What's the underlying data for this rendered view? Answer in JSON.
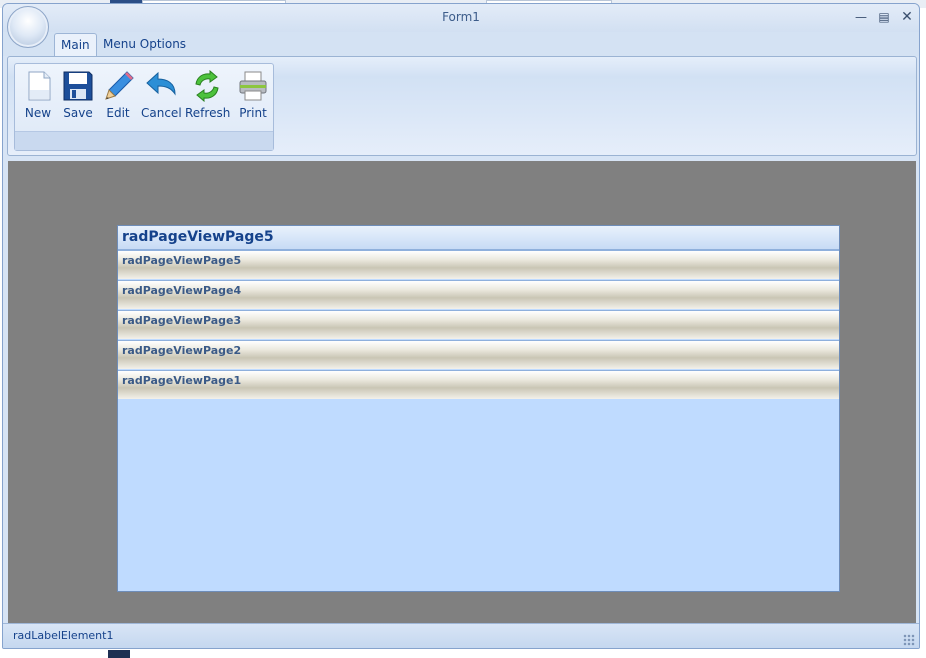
{
  "window": {
    "title": "Form1"
  },
  "ribbon": {
    "tabs": [
      {
        "label": "Main",
        "selected": true
      },
      {
        "label": "Menu Options",
        "selected": false
      }
    ],
    "buttons": [
      {
        "label": "New",
        "icon": "new-document-icon"
      },
      {
        "label": "Save",
        "icon": "floppy-disk-icon"
      },
      {
        "label": "Edit",
        "icon": "pencil-icon"
      },
      {
        "label": "Cancel",
        "icon": "undo-arrow-icon"
      },
      {
        "label": "Refresh",
        "icon": "refresh-icon"
      },
      {
        "label": "Print",
        "icon": "printer-icon"
      }
    ]
  },
  "page_view": {
    "header": "radPageViewPage5",
    "items": [
      "radPageViewPage5",
      "radPageViewPage4",
      "radPageViewPage3",
      "radPageViewPage2",
      "radPageViewPage1"
    ]
  },
  "status": {
    "label": "radLabelElement1"
  }
}
